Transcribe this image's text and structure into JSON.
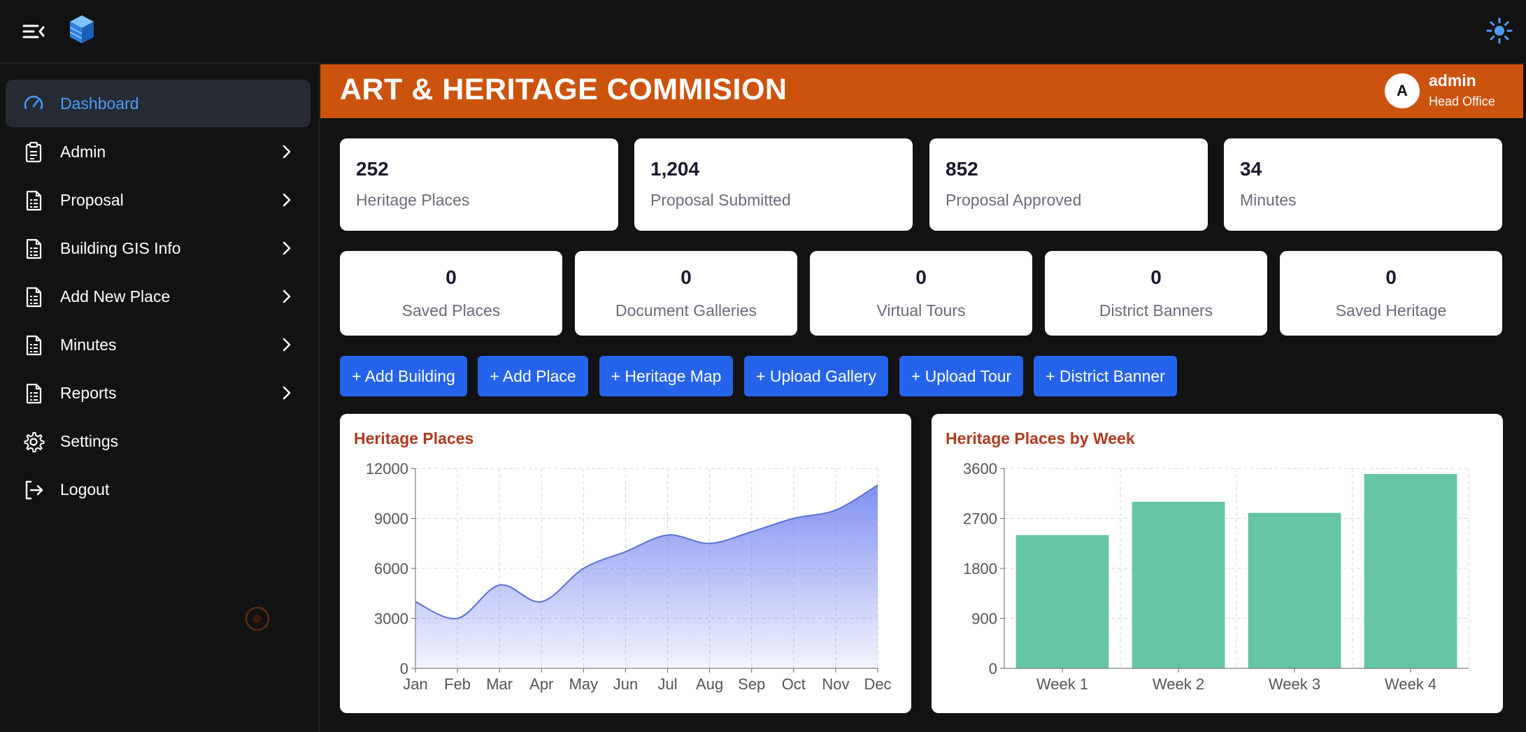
{
  "app": {
    "title": "ART & HERITAGE COMMISION",
    "user": {
      "avatar_letter": "A",
      "name": "admin",
      "role": "Head Office"
    }
  },
  "icons": {
    "menu_toggle": "menu-collapse-icon",
    "logo": "cube-logo-icon",
    "theme": "sun-icon",
    "loader": "spinner-icon"
  },
  "colors": {
    "accent": "#4a9eff",
    "banner": "#cc530d",
    "button": "#2563eb",
    "chart_title": "#b03a1e",
    "area": "#6b7ef0",
    "bar": "#66c5a6"
  },
  "sidebar": {
    "items": [
      {
        "label": "Dashboard",
        "icon": "speedometer-icon",
        "active": true,
        "has_submenu": false
      },
      {
        "label": "Admin",
        "icon": "clipboard-icon",
        "active": false,
        "has_submenu": true
      },
      {
        "label": "Proposal",
        "icon": "document-icon",
        "active": false,
        "has_submenu": true
      },
      {
        "label": "Building GIS Info",
        "icon": "document-icon",
        "active": false,
        "has_submenu": true
      },
      {
        "label": "Add New Place",
        "icon": "document-icon",
        "active": false,
        "has_submenu": true
      },
      {
        "label": "Minutes",
        "icon": "document-icon",
        "active": false,
        "has_submenu": true
      },
      {
        "label": "Reports",
        "icon": "document-icon",
        "active": false,
        "has_submenu": true
      },
      {
        "label": "Settings",
        "icon": "gear-icon",
        "active": false,
        "has_submenu": false
      },
      {
        "label": "Logout",
        "icon": "logout-icon",
        "active": false,
        "has_submenu": false
      }
    ]
  },
  "stats": [
    {
      "value": "252",
      "label": "Heritage Places"
    },
    {
      "value": "1,204",
      "label": "Proposal Submitted"
    },
    {
      "value": "852",
      "label": "Proposal Approved"
    },
    {
      "value": "34",
      "label": "Minutes"
    }
  ],
  "mini_stats": [
    {
      "value": "0",
      "label": "Saved Places"
    },
    {
      "value": "0",
      "label": "Document Galleries"
    },
    {
      "value": "0",
      "label": "Virtual Tours"
    },
    {
      "value": "0",
      "label": "District Banners"
    },
    {
      "value": "0",
      "label": "Saved Heritage"
    }
  ],
  "actions": [
    "+ Add Building",
    "+ Add Place",
    "+ Heritage Map",
    "+ Upload Gallery",
    "+ Upload Tour",
    "+ District Banner"
  ],
  "chart_data": [
    {
      "type": "area",
      "title": "Heritage Places",
      "categories": [
        "Jan",
        "Feb",
        "Mar",
        "Apr",
        "May",
        "Jun",
        "Jul",
        "Aug",
        "Sep",
        "Oct",
        "Nov",
        "Dec"
      ],
      "values": [
        4000,
        3000,
        5000,
        4000,
        6000,
        7000,
        8000,
        7500,
        8200,
        9000,
        9500,
        11000
      ],
      "ylim": [
        0,
        12000
      ],
      "yticks": [
        "0",
        "3000",
        "6000",
        "9000",
        "12000"
      ],
      "grid": true
    },
    {
      "type": "bar",
      "title": "Heritage Places by Week",
      "categories": [
        "Week 1",
        "Week 2",
        "Week 3",
        "Week 4"
      ],
      "values": [
        2400,
        3000,
        2800,
        3500
      ],
      "ylim": [
        0,
        3600
      ],
      "yticks": [
        "0",
        "900",
        "1800",
        "2700",
        "3600"
      ],
      "grid": true
    }
  ]
}
